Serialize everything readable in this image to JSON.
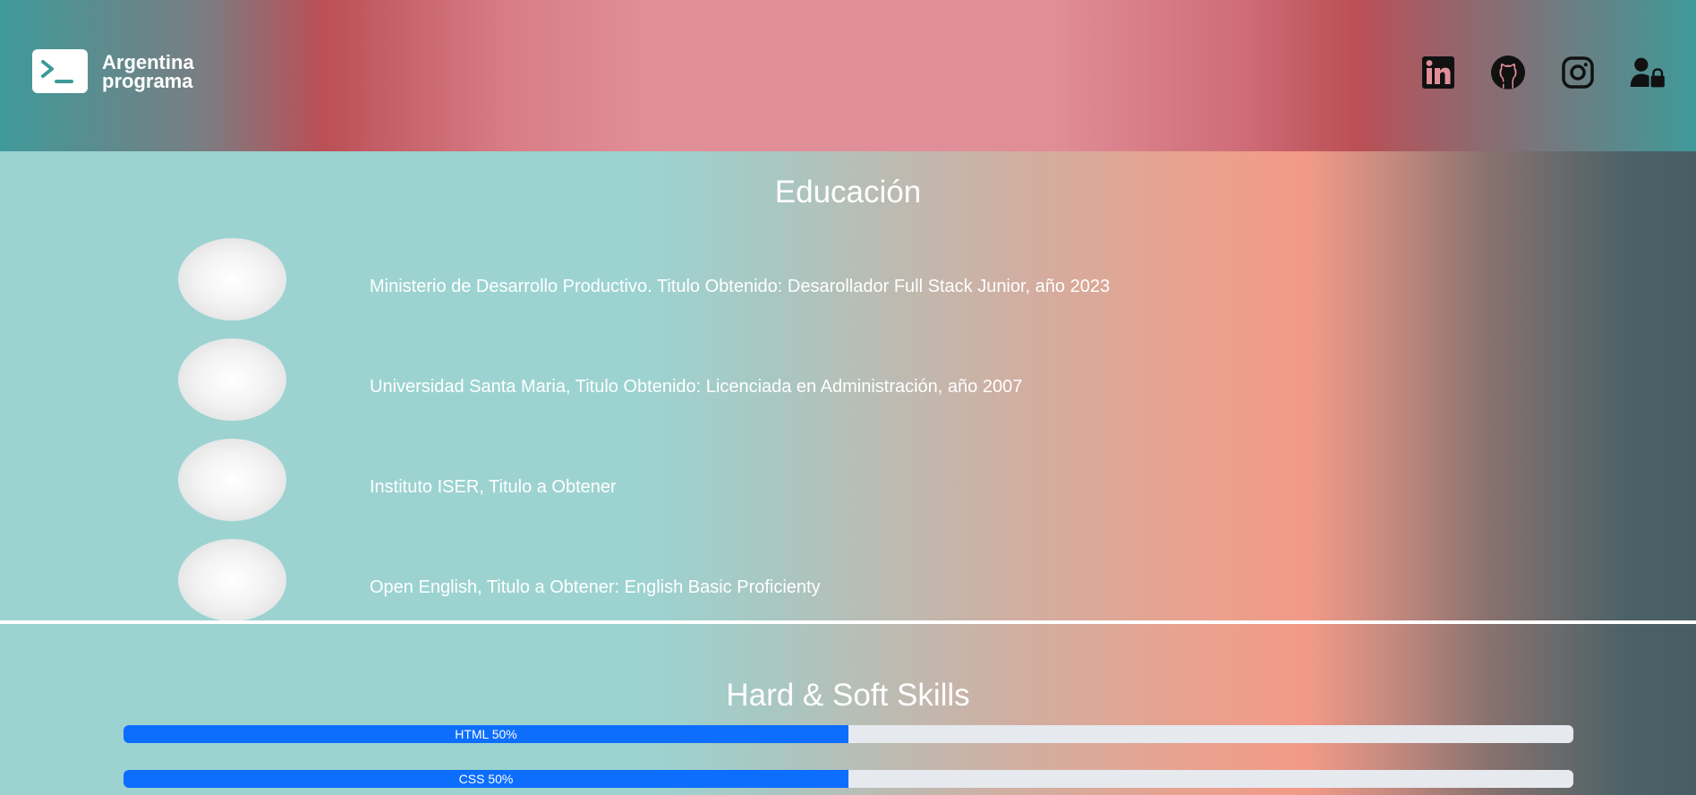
{
  "header": {
    "logo_line1": "Argentina",
    "logo_line2": "programa",
    "icons": [
      "linkedin-icon",
      "github-icon",
      "instagram-icon",
      "user-lock-icon"
    ]
  },
  "education": {
    "title": "Educación",
    "items": [
      {
        "text": "Ministerio de Desarrollo Productivo. Titulo Obtenido: Desarollador Full Stack Junior, año 2023"
      },
      {
        "text": "Universidad Santa Maria, Titulo Obtenido: Licenciada en Administración, año 2007"
      },
      {
        "text": "Instituto ISER, Titulo a Obtener"
      },
      {
        "text": "Open English, Titulo a Obtener: English Basic Proficienty"
      }
    ]
  },
  "skills": {
    "title": "Hard & Soft Skills",
    "bars": [
      {
        "label": "HTML 50%",
        "percent": 50
      },
      {
        "label": "CSS 50%",
        "percent": 50
      }
    ]
  },
  "colors": {
    "progress": "#0d6efd",
    "track": "#e6e9ee",
    "logo_teal": "#3f9a9a"
  }
}
